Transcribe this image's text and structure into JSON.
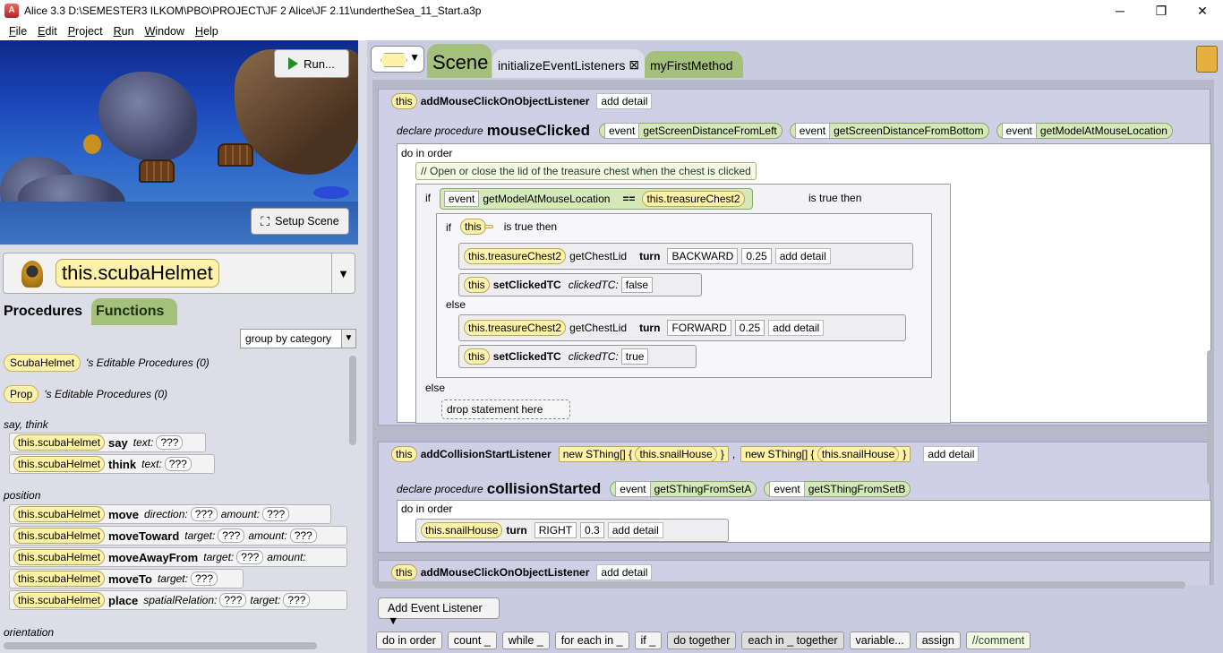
{
  "window": {
    "title": "Alice  3.3 D:\\SEMESTER3 ILKOM\\PBO\\PROJECT\\JF 2 Alice\\JF 2.11\\undertheSea_11_Start.a3p",
    "min": "─",
    "max": "❐",
    "close": "✕"
  },
  "menu": [
    "File",
    "Edit",
    "Project",
    "Run",
    "Window",
    "Help"
  ],
  "scene": {
    "run_label": "Run...",
    "setup_label": "Setup Scene"
  },
  "selector": {
    "name": "this.scubaHelmet",
    "arrow": "▼"
  },
  "left_tabs": {
    "procedures": "Procedures",
    "functions": "Functions"
  },
  "group_by": {
    "value": "group by category",
    "arrow": "▼"
  },
  "editable": [
    {
      "cls": "ScubaHelmet",
      "text": "'s Editable Procedures (0)"
    },
    {
      "cls": "Prop",
      "text": "'s Editable Procedures (0)"
    }
  ],
  "categories": {
    "say": "say, think",
    "position": "position",
    "orientation": "orientation"
  },
  "procs": [
    {
      "obj": "this.scubaHelmet",
      "m": "say",
      "p1": "text:",
      "v1": "???"
    },
    {
      "obj": "this.scubaHelmet",
      "m": "think",
      "p1": "text:",
      "v1": "???"
    },
    {
      "obj": "this.scubaHelmet",
      "m": "move",
      "p1": "direction:",
      "v1": "???",
      "p2": "amount:",
      "v2": "???"
    },
    {
      "obj": "this.scubaHelmet",
      "m": "moveToward",
      "p1": "target:",
      "v1": "???",
      "p2": "amount:",
      "v2": "???"
    },
    {
      "obj": "this.scubaHelmet",
      "m": "moveAwayFrom",
      "p1": "target:",
      "v1": "???",
      "p2": "amount:",
      "v2": ""
    },
    {
      "obj": "this.scubaHelmet",
      "m": "moveTo",
      "p1": "target:",
      "v1": "???"
    },
    {
      "obj": "this.scubaHelmet",
      "m": "place",
      "p1": "spatialRelation:",
      "v1": "???",
      "p2": "target:",
      "v2": "???"
    }
  ],
  "tabs": {
    "scene": "Scene",
    "init": "initializeEventListeners",
    "init_close": "⊠",
    "first": "myFirstMethod"
  },
  "listener1": {
    "this": "this",
    "name": "addMouseClickOnObjectListener",
    "detail": "add detail",
    "declare": "declare procedure",
    "proc": "mouseClicked",
    "params": [
      "getScreenDistanceFromLeft",
      "getScreenDistanceFromBottom",
      "getModelAtMouseLocation"
    ],
    "event": "event",
    "do": "do in order",
    "comment": "// Open or close the lid of the treasure chest when the chest is clicked",
    "if": "if",
    "fn": "getModelAtMouseLocation",
    "eq": "==",
    "chest": "this.treasureChest2",
    "istrue": "is true then",
    "if2": "if",
    ".clicked": ".clickedTC",
    "istrue2": "is true then",
    "getlid": "getChestLid",
    "turn": "turn",
    "backward": "BACKWARD",
    "forward": "FORWARD",
    "amt": "0.25",
    "setc": "setClickedTC",
    "cparam": "clickedTC:",
    "false": "false",
    "true": "true",
    "else": "else",
    "drop": "drop statement here"
  },
  "listener2": {
    "this": "this",
    "name": "addCollisionStartListener",
    "newa": "new SThing[] {",
    "snail": "this.snailHouse",
    "close": "}",
    "sep": ",",
    "detail": "add detail",
    "declare": "declare procedure",
    "proc": "collisionStarted",
    "event": "event",
    "params": [
      "getSThingFromSetA",
      "getSThingFromSetB"
    ],
    "do": "do in order",
    "turn": "turn",
    "right": "RIGHT",
    "amt": "0.3"
  },
  "listener3": {
    "this": "this",
    "name": "addMouseClickOnObjectListener",
    "detail": "add detail"
  },
  "add_listener": "Add Event Listener ▼",
  "statements": [
    "do in order",
    "count _",
    "while _",
    "for each in _",
    "if _",
    "do together",
    "each in _ together",
    "variable...",
    "assign",
    "//comment"
  ]
}
